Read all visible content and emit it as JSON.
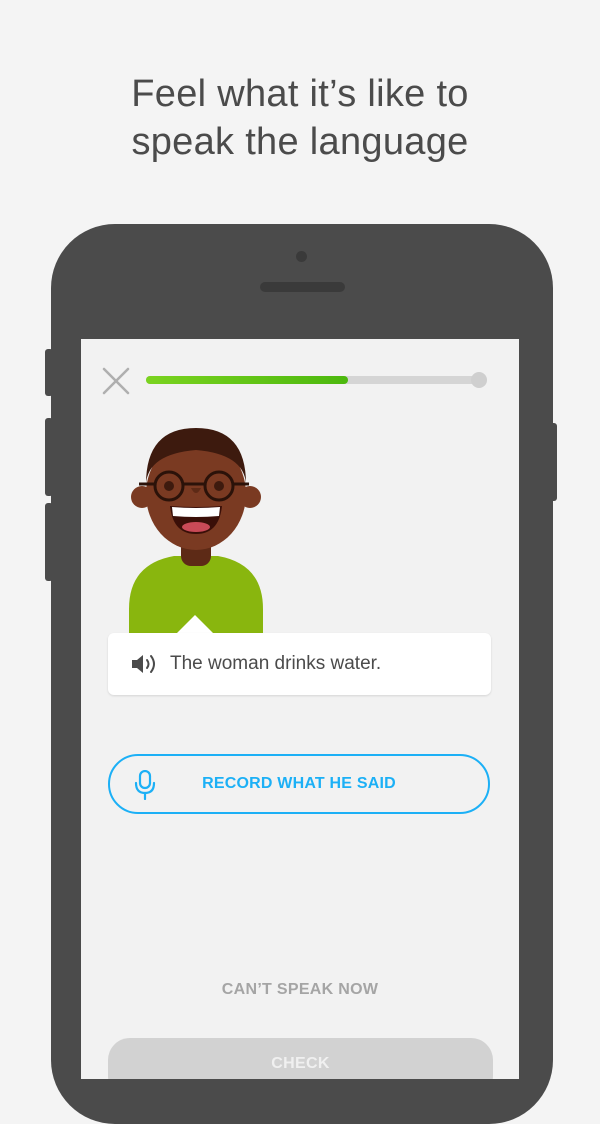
{
  "headline": {
    "line1": "Feel what it’s like to",
    "line2": "speak the language"
  },
  "lesson": {
    "progress": 0.6,
    "sentence": "The woman drinks water.",
    "record_label": "RECORD WHAT HE SAID",
    "cant_speak_label": "CAN’T SPEAK NOW",
    "check_label": "CHECK"
  },
  "icons": {
    "close": "close-icon",
    "speaker": "speaker-icon",
    "microphone": "microphone-icon"
  },
  "colors": {
    "background": "#f4f4f4",
    "phone_frame": "#4b4b4b",
    "progress_green": "#58cc02",
    "accent_blue": "#1cb0f6",
    "character_shirt": "#89b60e"
  }
}
